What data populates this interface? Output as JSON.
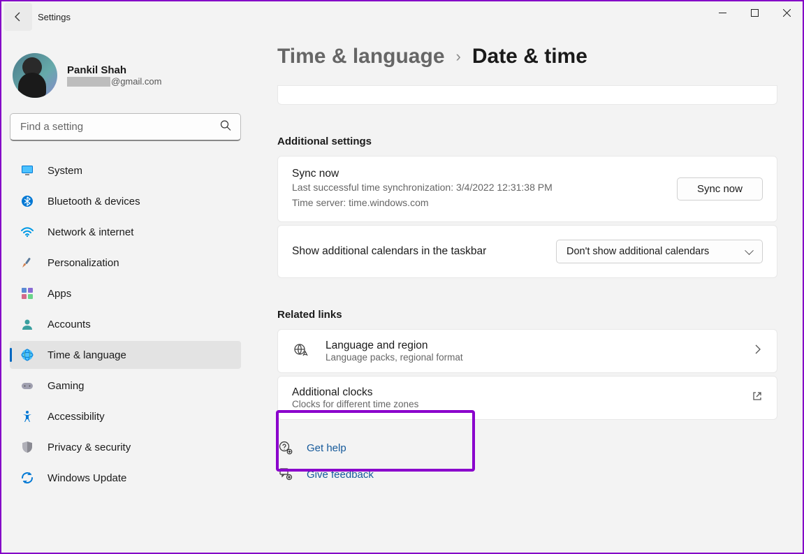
{
  "window": {
    "title": "Settings"
  },
  "profile": {
    "name": "Pankil Shah",
    "email_domain": "@gmail.com"
  },
  "search": {
    "placeholder": "Find a setting"
  },
  "nav": [
    {
      "label": "System",
      "icon": "monitor"
    },
    {
      "label": "Bluetooth & devices",
      "icon": "bluetooth"
    },
    {
      "label": "Network & internet",
      "icon": "wifi"
    },
    {
      "label": "Personalization",
      "icon": "brush"
    },
    {
      "label": "Apps",
      "icon": "apps"
    },
    {
      "label": "Accounts",
      "icon": "person"
    },
    {
      "label": "Time & language",
      "icon": "globe",
      "selected": true
    },
    {
      "label": "Gaming",
      "icon": "gamepad"
    },
    {
      "label": "Accessibility",
      "icon": "accessibility"
    },
    {
      "label": "Privacy & security",
      "icon": "shield"
    },
    {
      "label": "Windows Update",
      "icon": "update"
    }
  ],
  "breadcrumb": {
    "parent": "Time & language",
    "current": "Date & time"
  },
  "sections": {
    "additional_title": "Additional settings",
    "sync": {
      "title": "Sync now",
      "last_sync": "Last successful time synchronization: 3/4/2022 12:31:38 PM",
      "server": "Time server: time.windows.com",
      "button": "Sync now"
    },
    "calendars": {
      "label": "Show additional calendars in the taskbar",
      "value": "Don't show additional calendars"
    },
    "related_title": "Related links",
    "lang_region": {
      "title": "Language and region",
      "sub": "Language packs, regional format"
    },
    "add_clocks": {
      "title": "Additional clocks",
      "sub": "Clocks for different time zones"
    }
  },
  "footer": {
    "help": "Get help",
    "feedback": "Give feedback"
  }
}
